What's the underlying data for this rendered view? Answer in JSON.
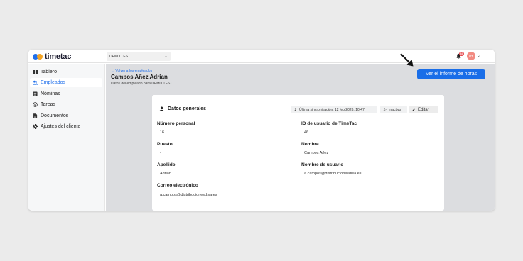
{
  "app": {
    "logo": "timetac"
  },
  "topbar": {
    "company": "DEMO TEST",
    "notifications_count": "60",
    "avatar_initials": "PT"
  },
  "sidebar": {
    "items": [
      {
        "label": "Tablero",
        "icon": "dashboard-icon"
      },
      {
        "label": "Empleados",
        "icon": "users-icon",
        "active": true
      },
      {
        "label": "Nóminas",
        "icon": "payroll-icon"
      },
      {
        "label": "Tareas",
        "icon": "check-circle-icon"
      },
      {
        "label": "Documentos",
        "icon": "document-icon"
      },
      {
        "label": "Ajustes del cliente",
        "icon": "gear-icon"
      }
    ]
  },
  "header": {
    "back_link": "← Volver a los empleados",
    "employee_name": "Campos Añez Adrian",
    "subtitle": "Datos del empleado para DEMO TEST",
    "report_button": "Ver el informe de horas"
  },
  "card": {
    "title": "Datos generales",
    "sync_status": "Última sincronización: 12 feb 2026, 10:47",
    "status": "Inactivo",
    "edit_button": "Editar",
    "fields": {
      "personal_number": {
        "label": "Número personal",
        "value": "16"
      },
      "timetac_user_id": {
        "label": "ID de usuario de TimeTac",
        "value": "46"
      },
      "position": {
        "label": "Puesto",
        "value": "-"
      },
      "first_name": {
        "label": "Nombre",
        "value": "Campos Añez"
      },
      "last_name": {
        "label": "Apellido",
        "value": "Adrian"
      },
      "username": {
        "label": "Nombre de usuario",
        "value": "a.campos@distribucionesdisa.es"
      },
      "email": {
        "label": "Correo electrónico",
        "value": "a.campos@distribucionesdisa.es"
      }
    }
  },
  "colors": {
    "accent": "#1a6ee8",
    "badge": "#e5484d"
  }
}
